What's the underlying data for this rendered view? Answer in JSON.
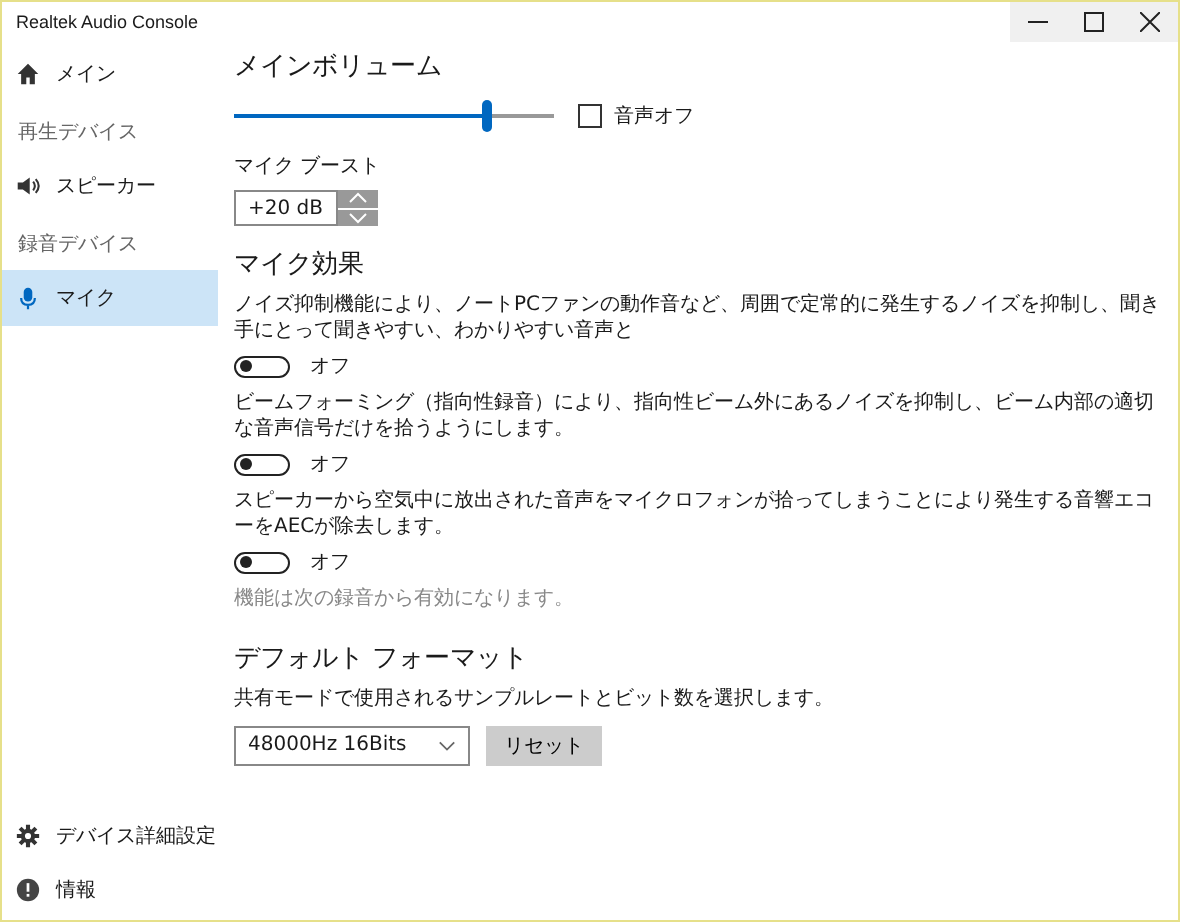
{
  "window": {
    "title": "Realtek Audio Console"
  },
  "sidebar": {
    "items": [
      {
        "kind": "item",
        "label": "メイン",
        "selected": false
      },
      {
        "kind": "header",
        "label": "再生デバイス"
      },
      {
        "kind": "item",
        "label": "スピーカー",
        "selected": false
      },
      {
        "kind": "header",
        "label": "録音デバイス"
      },
      {
        "kind": "item",
        "label": "マイク",
        "selected": true
      }
    ],
    "footer": [
      {
        "label": "デバイス詳細設定"
      },
      {
        "label": "情報"
      }
    ]
  },
  "main_volume": {
    "title": "メインボリューム",
    "level": 0.79,
    "mute": {
      "label": "音声オフ",
      "checked": false
    }
  },
  "mic_boost": {
    "label": "マイク ブースト",
    "value": "+20 dB"
  },
  "mic_effects": {
    "title": "マイク効果",
    "effects": [
      {
        "description": "ノイズ抑制機能により、ノートPCファンの動作音など、周囲で定常的に発生するノイズを抑制し、聞き手にとって聞きやすい、わかりやすい音声と",
        "toggle_label": "オフ",
        "on": false
      },
      {
        "description": "ビームフォーミング（指向性録音）により、指向性ビーム外にあるノイズを抑制し、ビーム内部の適切な音声信号だけを拾うようにします。",
        "toggle_label": "オフ",
        "on": false
      },
      {
        "description": "スピーカーから空気中に放出された音声をマイクロフォンが拾ってしまうことにより発生する音響エコーをAECが除去します。",
        "toggle_label": "オフ",
        "on": false
      }
    ],
    "note": "機能は次の録音から有効になります。"
  },
  "default_format": {
    "title": "デフォルト フォーマット",
    "description": "共有モードで使用されるサンプルレートとビット数を選択します。",
    "value": "48000Hz 16Bits",
    "reset_button": "リセット"
  }
}
